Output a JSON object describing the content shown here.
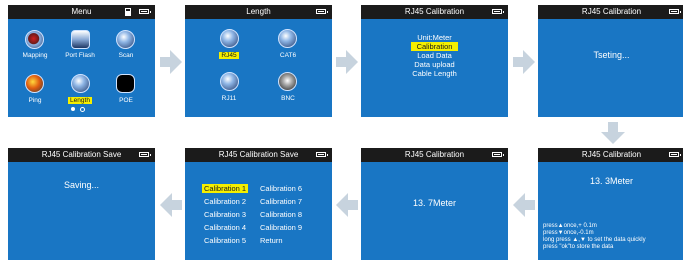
{
  "screens": {
    "menu": {
      "title": "Menu",
      "items": [
        "Mapping",
        "Port Flash",
        "Scan",
        "Ping",
        "Length",
        "POE"
      ]
    },
    "length": {
      "title": "Length",
      "items": [
        "RJ45",
        "CAT6",
        "RJ11",
        "BNC"
      ]
    },
    "rj45_menu": {
      "title": "RJ45 Calibration",
      "items": [
        "Unit:Meter",
        "Calibration",
        "Load Data",
        "Data upload",
        "Cable  Length"
      ]
    },
    "testing": {
      "title": "RJ45 Calibration",
      "text": "Tseting..."
    },
    "adjust": {
      "title": "RJ45 Calibration",
      "value": "13. 3Meter",
      "help1": "press",
      "help1b": "once,+ 0.1m",
      "help2": "press",
      "help2b": "once,-0.1m",
      "help3": "long press",
      "help3b": "to set the data quickly",
      "help4": "press \"ok\"to store the data"
    },
    "value": {
      "title": "RJ45 Calibration",
      "value": "13. 7Meter"
    },
    "save_menu": {
      "title": "RJ45 Calibration Save",
      "left": [
        "Calibration 1",
        "Calibration 2",
        "Calibration 3",
        "Calibration 4",
        "Calibration 5"
      ],
      "right": [
        "Calibration 6",
        "Calibration 7",
        "Calibration 8",
        "Calibration 9",
        "Return"
      ]
    },
    "saving": {
      "title": "RJ45 Calibration Save",
      "text": "Saving..."
    }
  },
  "colors": {
    "screen_bg": "#1976c4",
    "titlebar": "#1b1b1b",
    "highlight": "#f5ef00",
    "arrow": "#c7d3de"
  },
  "icons": {
    "battery": "battery-icon",
    "sd": "sd-card-icon",
    "arrow": "flow-arrow-icon"
  }
}
